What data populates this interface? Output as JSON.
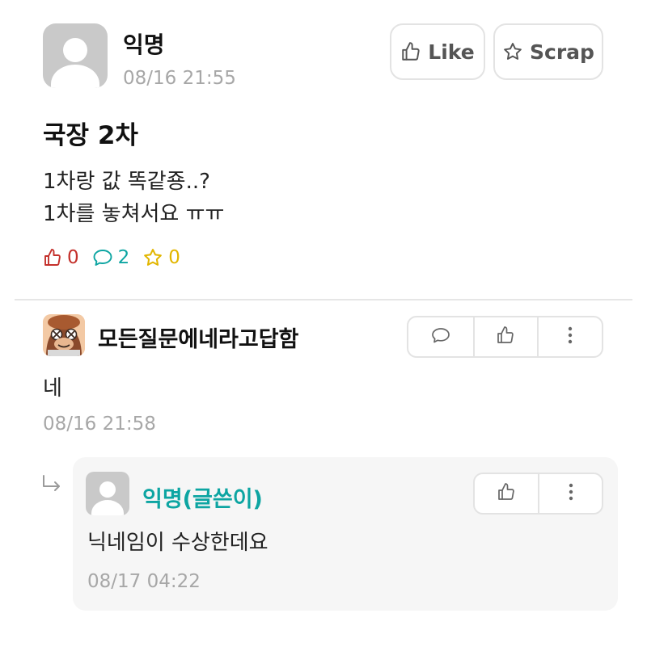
{
  "post": {
    "author": "익명",
    "date": "08/16 21:55",
    "like_label": "Like",
    "scrap_label": "Scrap",
    "title": "국장 2차",
    "body_lines": [
      "1차랑 값 똑같죵..?",
      "1차를 놓쳐서요 ㅠㅠ"
    ],
    "counts": {
      "likes": "0",
      "comments": "2",
      "scraps": "0"
    }
  },
  "comment": {
    "author": "모든질문에네라고답함",
    "text": "네",
    "date": "08/16 21:58",
    "actions": [
      "comment-icon",
      "like-icon",
      "more-icon"
    ]
  },
  "reply": {
    "author": "익명(글쓴이)",
    "text": "닉네임이 수상한데요",
    "date": "08/17 04:22",
    "actions": [
      "like-icon",
      "more-icon"
    ]
  },
  "colors": {
    "like_count": "#c4302b",
    "comment_count": "#0da5a2",
    "scrap_count": "#e2b600",
    "op_author": "#0da5a2",
    "meta_gray": "#a7a7a7"
  }
}
